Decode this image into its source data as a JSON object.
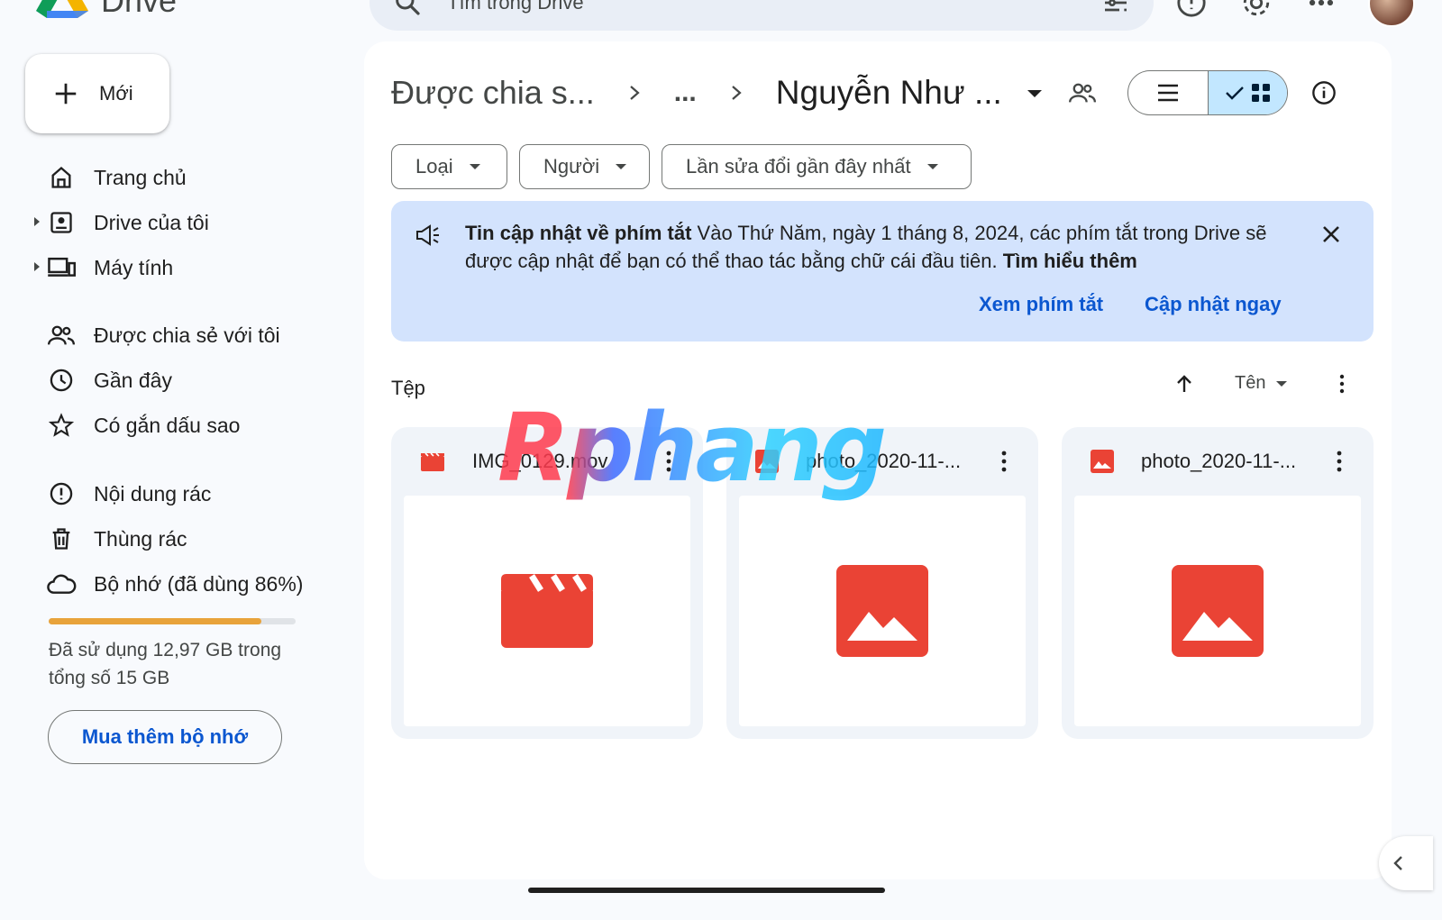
{
  "app": {
    "name": "Drive"
  },
  "search": {
    "placeholder": "Tìm trong Drive"
  },
  "new_button": {
    "label": "Mới"
  },
  "sidebar": {
    "items": [
      {
        "label": "Trang chủ",
        "icon": "home-icon"
      },
      {
        "label": "Drive của tôi",
        "icon": "my-drive-icon"
      },
      {
        "label": "Máy tính",
        "icon": "computer-icon"
      },
      {
        "label": "Được chia sẻ với tôi",
        "icon": "shared-icon"
      },
      {
        "label": "Gần đây",
        "icon": "clock-icon"
      },
      {
        "label": "Có gắn dấu sao",
        "icon": "star-icon"
      },
      {
        "label": "Nội dung rác",
        "icon": "spam-icon"
      },
      {
        "label": "Thùng rác",
        "icon": "trash-icon"
      },
      {
        "label": "Bộ nhớ (đã dùng 86%)",
        "icon": "cloud-icon"
      }
    ],
    "storage": {
      "used_fraction": 0.86,
      "text": "Đã sử dụng 12,97 GB trong tổng số 15 GB",
      "buy_label": "Mua thêm bộ nhớ",
      "bar_color": "#e8a33b"
    }
  },
  "breadcrumb": {
    "root": "Được chia s...",
    "ellipsis": "...",
    "current": "Nguyễn Như ..."
  },
  "filters": {
    "type": "Loại",
    "people": "Người",
    "modified": "Lần sửa đổi gần đây nhất"
  },
  "banner": {
    "title": "Tin cập nhật về phím tắt",
    "body": "Vào Thứ Năm, ngày 1 tháng 8, 2024, các phím tắt trong Drive sẽ được cập nhật để bạn có thể thao tác bằng chữ cái đầu tiên.",
    "learn_more": "Tìm hiểu thêm",
    "action_view": "Xem phím tắt",
    "action_update": "Cập nhật ngay",
    "bg_color": "#d3e3fd"
  },
  "files": {
    "section_label": "Tệp",
    "sort_label": "Tên",
    "items": [
      {
        "name": "IMG_0129.mov",
        "type": "video"
      },
      {
        "name": "photo_2020-11-...",
        "type": "image"
      },
      {
        "name": "photo_2020-11-...",
        "type": "image"
      }
    ]
  },
  "watermark": {
    "text": "Rphang"
  },
  "colors": {
    "accent": "#0b57d0",
    "file_red": "#ea4335",
    "selected_view": "#c2e7ff"
  }
}
